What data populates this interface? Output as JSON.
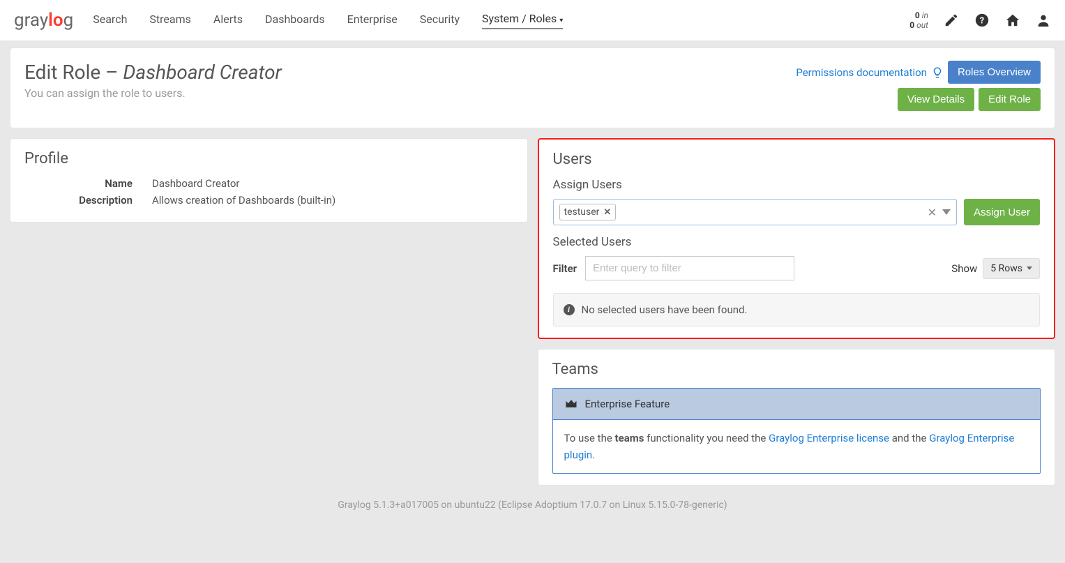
{
  "nav": {
    "logo": {
      "part1": "gray",
      "part2": "lo",
      "part3": "g"
    },
    "items": [
      "Search",
      "Streams",
      "Alerts",
      "Dashboards",
      "Enterprise",
      "Security",
      "System / Roles"
    ],
    "activeIndex": 6,
    "throughput": {
      "in_val": "0",
      "in_lbl": "in",
      "out_val": "0",
      "out_lbl": "out"
    }
  },
  "header": {
    "title_prefix": "Edit Role – ",
    "title_name": "Dashboard Creator",
    "subtitle": "You can assign the role to users.",
    "perm_link": "Permissions documentation",
    "roles_overview_btn": "Roles Overview",
    "view_details_btn": "View Details",
    "edit_role_btn": "Edit Role"
  },
  "profile": {
    "heading": "Profile",
    "name_label": "Name",
    "name_value": "Dashboard Creator",
    "desc_label": "Description",
    "desc_value": "Allows creation of Dashboards (built-in)"
  },
  "users": {
    "heading": "Users",
    "assign_heading": "Assign Users",
    "chip": "testuser",
    "assign_btn": "Assign User",
    "selected_heading": "Selected Users",
    "filter_label": "Filter",
    "filter_placeholder": "Enter query to filter",
    "show_label": "Show",
    "rows_label": "5 Rows",
    "empty_msg": "No selected users have been found."
  },
  "teams": {
    "heading": "Teams",
    "feature_title": "Enterprise Feature",
    "body_pre": "To use the ",
    "body_bold": "teams",
    "body_mid": " functionality you need the ",
    "link1": "Graylog Enterprise license",
    "body_mid2": " and the ",
    "link2": "Graylog Enterprise plugin",
    "body_end": "."
  },
  "footer": "Graylog 5.1.3+a017005 on ubuntu22 (Eclipse Adoptium 17.0.7 on Linux 5.15.0-78-generic)"
}
